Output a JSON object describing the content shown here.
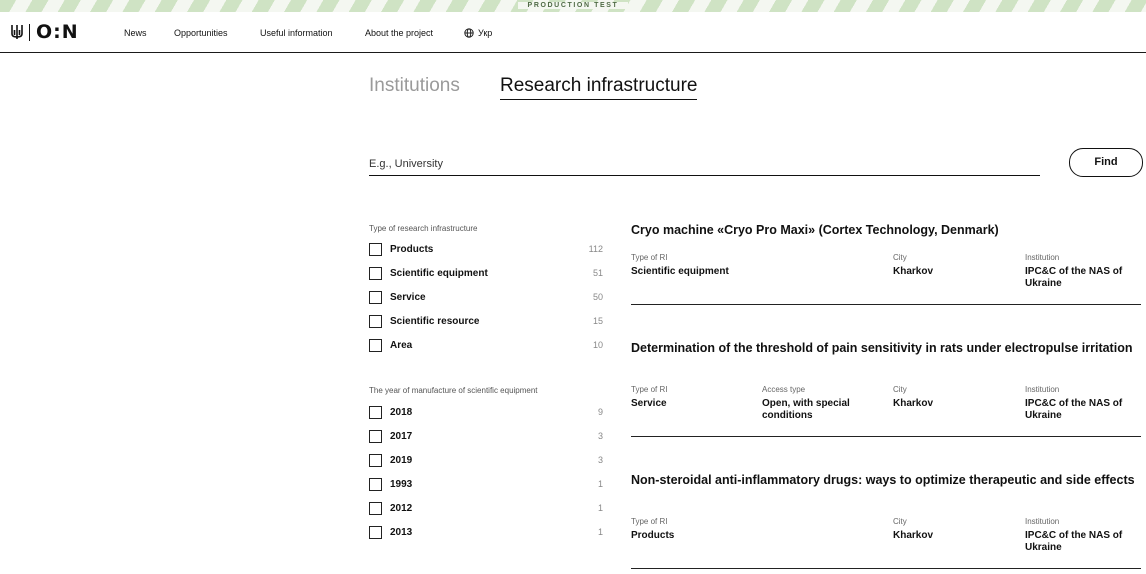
{
  "banner": {
    "text": "PRODUCTION TEST"
  },
  "header": {
    "logo_text": "O:N",
    "nav": [
      {
        "label": "News"
      },
      {
        "label": "Opportunities"
      },
      {
        "label": "Useful information"
      },
      {
        "label": "About the project"
      }
    ],
    "language": "Укр"
  },
  "tabs": {
    "institutions": "Institutions",
    "research_infrastructure": "Research infrastructure",
    "active": "research_infrastructure"
  },
  "search": {
    "placeholder": "E.g., University",
    "value": "",
    "find_label": "Find"
  },
  "filters": {
    "type": {
      "title": "Type of research infrastructure",
      "items": [
        {
          "label": "Products",
          "count": "112",
          "checked": false
        },
        {
          "label": "Scientific equipment",
          "count": "51",
          "checked": false
        },
        {
          "label": "Service",
          "count": "50",
          "checked": false
        },
        {
          "label": "Scientific resource",
          "count": "15",
          "checked": false
        },
        {
          "label": "Area",
          "count": "10",
          "checked": false
        }
      ]
    },
    "year": {
      "title": "The year of manufacture of scientific equipment",
      "items": [
        {
          "label": "2018",
          "count": "9",
          "checked": false
        },
        {
          "label": "2017",
          "count": "3",
          "checked": false
        },
        {
          "label": "2019",
          "count": "3",
          "checked": false
        },
        {
          "label": "1993",
          "count": "1",
          "checked": false
        },
        {
          "label": "2012",
          "count": "1",
          "checked": false
        },
        {
          "label": "2013",
          "count": "1",
          "checked": false
        }
      ]
    }
  },
  "results": [
    {
      "title": "Cryo machine «Cryo Pro Maxi» (Cortex Technology, Denmark)",
      "type_label": "Type of RI",
      "type_value": "Scientific equipment",
      "city_label": "City",
      "city_value": "Kharkov",
      "institution_label": "Institution",
      "institution_value": "IPC&C of the NAS of Ukraine"
    },
    {
      "title": "Determination of the threshold of pain sensitivity in rats under electropulse irritation",
      "type_label": "Type of RI",
      "type_value": "Service",
      "access_label": "Access type",
      "access_value": "Open, with special conditions",
      "city_label": "City",
      "city_value": "Kharkov",
      "institution_label": "Institution",
      "institution_value": "IPC&C of the NAS of Ukraine"
    },
    {
      "title": "Non-steroidal anti-inflammatory drugs: ways to optimize therapeutic and side effects",
      "type_label": "Type of RI",
      "type_value": "Products",
      "city_label": "City",
      "city_value": "Kharkov",
      "institution_label": "Institution",
      "institution_value": "IPC&C of the NAS of Ukraine"
    }
  ]
}
